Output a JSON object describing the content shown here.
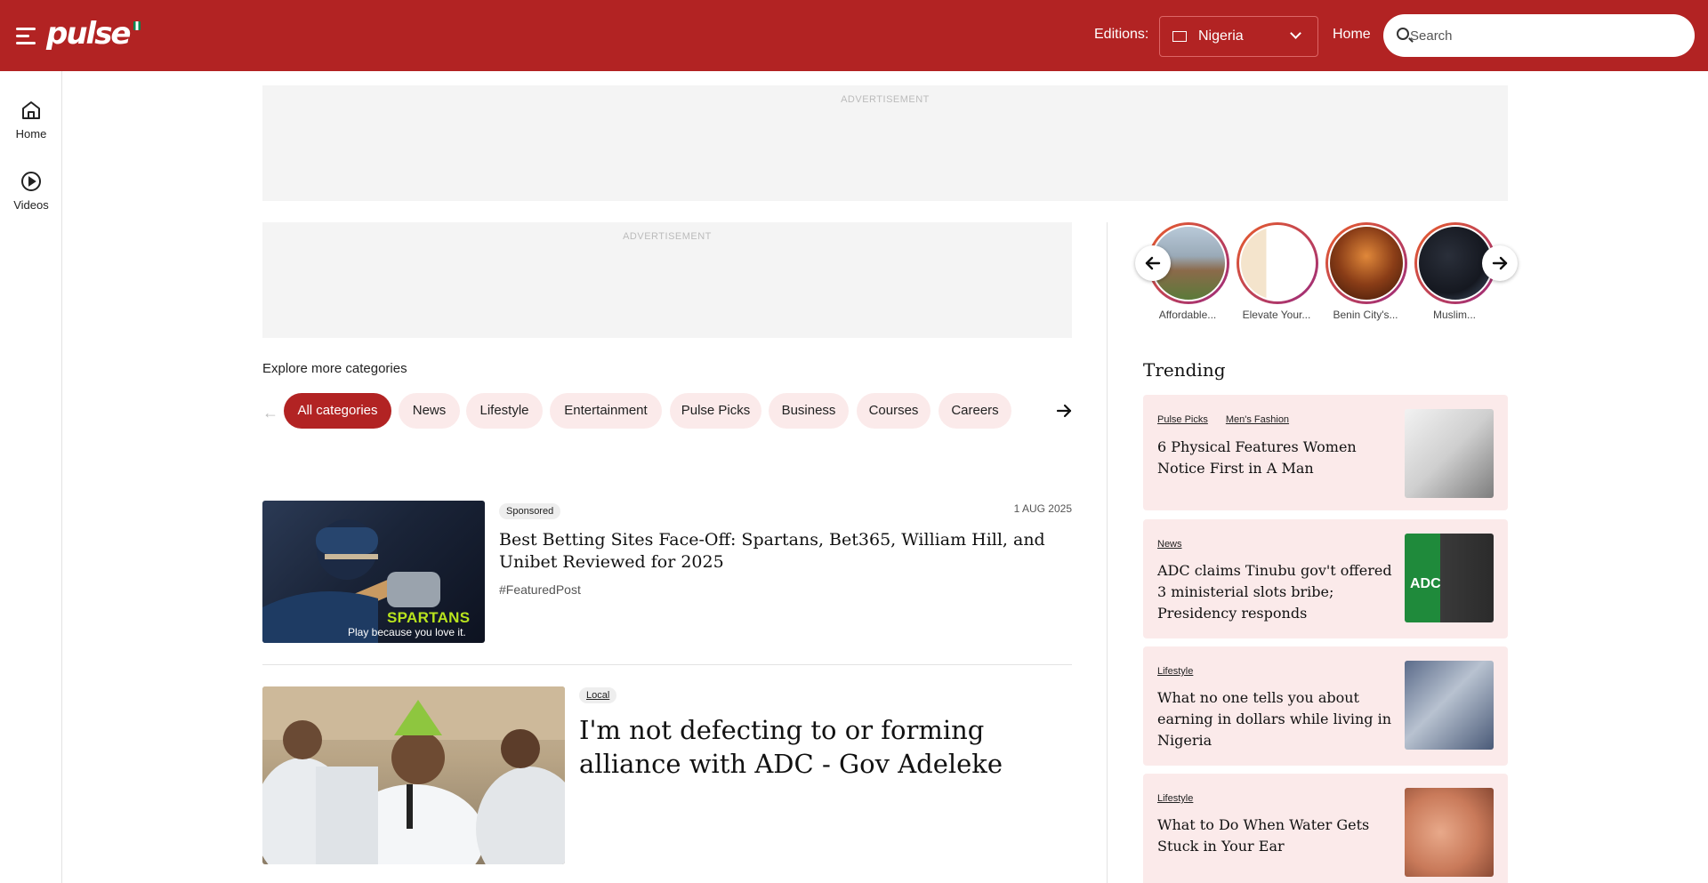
{
  "header": {
    "logo_text": "pulse",
    "editions_label": "Editions:",
    "edition_flag": "NG",
    "edition_value": "Nigeria",
    "home_label": "Home",
    "search_placeholder": "Search",
    "brand_color": "#b22323"
  },
  "sidenav": {
    "items": [
      {
        "label": "Home",
        "icon": "home-icon"
      },
      {
        "label": "Videos",
        "icon": "play-circle-icon"
      }
    ]
  },
  "ads": {
    "top_label": "ADVERTISEMENT",
    "mid_label": "ADVERTISEMENT"
  },
  "categories": {
    "heading": "Explore more categories",
    "items": [
      "All categories",
      "News",
      "Lifestyle",
      "Entertainment",
      "Pulse Picks",
      "Business",
      "Courses",
      "Careers"
    ],
    "active": "All categories"
  },
  "articles": [
    {
      "tag": "Sponsored",
      "date": "1 AUG 2025",
      "title": "Best Betting Sites Face-Off: Spartans, Bet365, William Hill, and Unibet Reviewed for 2025",
      "hashtag": "#FeaturedPost",
      "image_brand": "SPARTANS",
      "image_slogan": "Play because you love it."
    },
    {
      "tag": "Local",
      "title": "I'm not defecting to or forming alliance with ADC - Gov Adeleke"
    }
  ],
  "stories": [
    {
      "caption": "Affordable..."
    },
    {
      "caption": "Elevate Your..."
    },
    {
      "caption": "Benin City's..."
    },
    {
      "caption": "Muslim..."
    }
  ],
  "trending": {
    "heading": "Trending",
    "items": [
      {
        "tags": [
          "Pulse Picks",
          "Men's Fashion"
        ],
        "title": "6 Physical Features Women Notice First in A Man"
      },
      {
        "tags": [
          "News"
        ],
        "title": "ADC claims Tinubu gov't offered 3 ministerial slots bribe; Presidency responds",
        "image_text": "ADC"
      },
      {
        "tags": [
          "Lifestyle"
        ],
        "title": "What no one tells you about earning in dollars while living in Nigeria"
      },
      {
        "tags": [
          "Lifestyle"
        ],
        "title": "What to Do When Water Gets Stuck in Your Ear"
      }
    ]
  }
}
